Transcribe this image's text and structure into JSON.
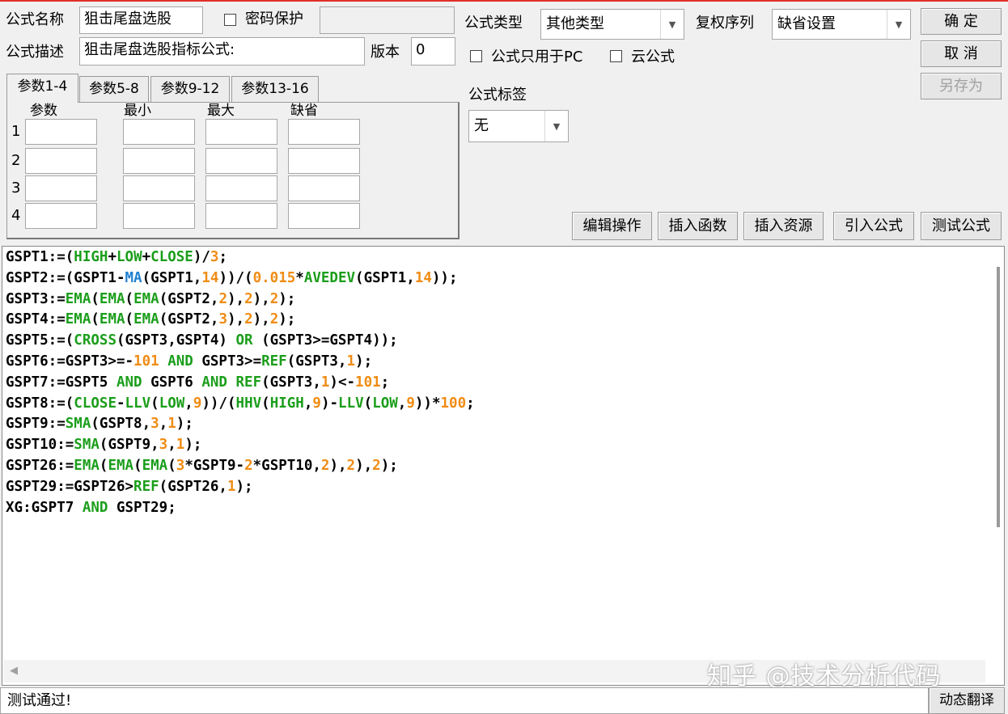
{
  "form": {
    "name_label": "公式名称",
    "name_value": "狙击尾盘选股",
    "password_label": "密码保护",
    "password_value": "",
    "desc_label": "公式描述",
    "desc_value": "狙击尾盘选股指标公式:",
    "version_label": "版本",
    "version_value": "0",
    "type_label": "公式类型",
    "type_value": "其他类型",
    "rights_label": "复权序列",
    "rights_value": "缺省设置",
    "pc_only_label": "公式只用于PC",
    "cloud_label": "云公式",
    "tag_label": "公式标签",
    "tag_value": "无"
  },
  "buttons": {
    "ok": "确 定",
    "cancel": "取 消",
    "save_as": "另存为",
    "edit_ops": "编辑操作",
    "insert_func": "插入函数",
    "insert_res": "插入资源",
    "import_formula": "引入公式",
    "test_formula": "测试公式",
    "dynamic_translate": "动态翻译"
  },
  "tabs": [
    "参数1-4",
    "参数5-8",
    "参数9-12",
    "参数13-16"
  ],
  "params": {
    "headers": [
      "参数",
      "最小",
      "最大",
      "缺省"
    ],
    "rows": [
      "1",
      "2",
      "3",
      "4"
    ]
  },
  "code_lines": [
    [
      [
        "GSPT1:=(",
        ""
      ],
      [
        "HIGH",
        "f"
      ],
      [
        "+",
        ""
      ],
      [
        "LOW",
        "f"
      ],
      [
        "+",
        ""
      ],
      [
        "CLOSE",
        "f"
      ],
      [
        ")/",
        ""
      ],
      [
        "3",
        "n"
      ],
      [
        ";",
        ""
      ]
    ],
    [
      [
        "GSPT2:=(GSPT1-",
        ""
      ],
      [
        "MA",
        "b"
      ],
      [
        "(GSPT1,",
        ""
      ],
      [
        "14",
        "n"
      ],
      [
        "))/(",
        ""
      ],
      [
        "0.015",
        "n"
      ],
      [
        "*",
        ""
      ],
      [
        "AVEDEV",
        "f"
      ],
      [
        "(GSPT1,",
        ""
      ],
      [
        "14",
        "n"
      ],
      [
        "));",
        ""
      ]
    ],
    [
      [
        "GSPT3:=",
        ""
      ],
      [
        "EMA",
        "f"
      ],
      [
        "(",
        ""
      ],
      [
        "EMA",
        "f"
      ],
      [
        "(",
        ""
      ],
      [
        "EMA",
        "f"
      ],
      [
        "(GSPT2,",
        ""
      ],
      [
        "2",
        "n"
      ],
      [
        "),",
        ""
      ],
      [
        "2",
        "n"
      ],
      [
        "),",
        ""
      ],
      [
        "2",
        "n"
      ],
      [
        ");",
        ""
      ]
    ],
    [
      [
        "GSPT4:=",
        ""
      ],
      [
        "EMA",
        "f"
      ],
      [
        "(",
        ""
      ],
      [
        "EMA",
        "f"
      ],
      [
        "(",
        ""
      ],
      [
        "EMA",
        "f"
      ],
      [
        "(GSPT2,",
        ""
      ],
      [
        "3",
        "n"
      ],
      [
        "),",
        ""
      ],
      [
        "2",
        "n"
      ],
      [
        "),",
        ""
      ],
      [
        "2",
        "n"
      ],
      [
        ");",
        ""
      ]
    ],
    [
      [
        "GSPT5:=(",
        ""
      ],
      [
        "CROSS",
        "f"
      ],
      [
        "(GSPT3,GSPT4) ",
        ""
      ],
      [
        "OR",
        "f"
      ],
      [
        " (GSPT3>=GSPT4));",
        ""
      ]
    ],
    [
      [
        "GSPT6:=GSPT3>=-",
        ""
      ],
      [
        "101",
        "n"
      ],
      [
        " ",
        ""
      ],
      [
        "AND",
        "f"
      ],
      [
        " GSPT3>=",
        ""
      ],
      [
        "REF",
        "f"
      ],
      [
        "(GSPT3,",
        ""
      ],
      [
        "1",
        "n"
      ],
      [
        ");",
        ""
      ]
    ],
    [
      [
        "GSPT7:=GSPT5 ",
        ""
      ],
      [
        "AND",
        "f"
      ],
      [
        " GSPT6 ",
        ""
      ],
      [
        "AND",
        "f"
      ],
      [
        " ",
        ""
      ],
      [
        "REF",
        "f"
      ],
      [
        "(GSPT3,",
        ""
      ],
      [
        "1",
        "n"
      ],
      [
        ")<-",
        ""
      ],
      [
        "101",
        "n"
      ],
      [
        ";",
        ""
      ]
    ],
    [
      [
        "GSPT8:=(",
        ""
      ],
      [
        "CLOSE",
        "f"
      ],
      [
        "-",
        ""
      ],
      [
        "LLV",
        "f"
      ],
      [
        "(",
        ""
      ],
      [
        "LOW",
        "f"
      ],
      [
        ",",
        ""
      ],
      [
        "9",
        "n"
      ],
      [
        "))/(",
        ""
      ],
      [
        "HHV",
        "f"
      ],
      [
        "(",
        ""
      ],
      [
        "HIGH",
        "f"
      ],
      [
        ",",
        ""
      ],
      [
        "9",
        "n"
      ],
      [
        ")-",
        ""
      ],
      [
        "LLV",
        "f"
      ],
      [
        "(",
        ""
      ],
      [
        "LOW",
        "f"
      ],
      [
        ",",
        ""
      ],
      [
        "9",
        "n"
      ],
      [
        "))*",
        ""
      ],
      [
        "100",
        "n"
      ],
      [
        ";",
        ""
      ]
    ],
    [
      [
        "GSPT9:=",
        ""
      ],
      [
        "SMA",
        "f"
      ],
      [
        "(GSPT8,",
        ""
      ],
      [
        "3",
        "n"
      ],
      [
        ",",
        ""
      ],
      [
        "1",
        "n"
      ],
      [
        ");",
        ""
      ]
    ],
    [
      [
        "GSPT10:=",
        ""
      ],
      [
        "SMA",
        "f"
      ],
      [
        "(GSPT9,",
        ""
      ],
      [
        "3",
        "n"
      ],
      [
        ",",
        ""
      ],
      [
        "1",
        "n"
      ],
      [
        ");",
        ""
      ]
    ],
    [
      [
        "GSPT26:=",
        ""
      ],
      [
        "EMA",
        "f"
      ],
      [
        "(",
        ""
      ],
      [
        "EMA",
        "f"
      ],
      [
        "(",
        ""
      ],
      [
        "EMA",
        "f"
      ],
      [
        "(",
        ""
      ],
      [
        "3",
        "n"
      ],
      [
        "*GSPT9-",
        ""
      ],
      [
        "2",
        "n"
      ],
      [
        "*GSPT10,",
        ""
      ],
      [
        "2",
        "n"
      ],
      [
        "),",
        ""
      ],
      [
        "2",
        "n"
      ],
      [
        "),",
        ""
      ],
      [
        "2",
        "n"
      ],
      [
        ");",
        ""
      ]
    ],
    [
      [
        "GSPT29:=GSPT26>",
        ""
      ],
      [
        "REF",
        "f"
      ],
      [
        "(GSPT26,",
        ""
      ],
      [
        "1",
        "n"
      ],
      [
        ");",
        ""
      ]
    ],
    [
      [
        "XG:GSPT7 ",
        ""
      ],
      [
        "AND",
        "f"
      ],
      [
        " GSPT29;",
        ""
      ]
    ]
  ],
  "status_text": "测试通过!",
  "watermark": "知乎 @技术分析代码",
  "colors": {
    "function": "#1b9e1b",
    "builtin": "#1e7fd0",
    "number": "#f08c14",
    "title_accent": "#e2302a"
  },
  "icons": {
    "dropdown": "chevron-down-icon",
    "scroll_left": "scroll-left-arrow-icon"
  }
}
